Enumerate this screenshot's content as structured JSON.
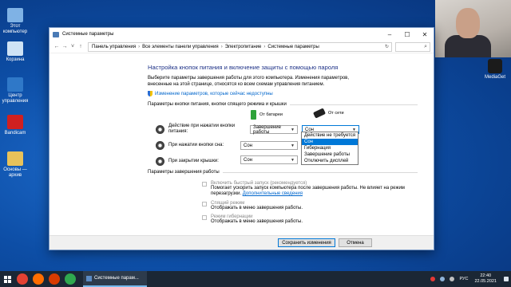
{
  "desktop": {
    "icons": [
      {
        "label": "Этот компьютер",
        "color": "#7fb2e5"
      },
      {
        "label": "Корзина",
        "color": "#cfe3f5"
      },
      {
        "label": "Центр управления",
        "color": "#2f78c8"
      },
      {
        "label": "Bandicam",
        "color": "#d02020"
      },
      {
        "label": "Основы — архив",
        "color": "#e8c25a"
      }
    ],
    "mediaget_label": "MediaGet"
  },
  "window": {
    "title": "Системные параметры",
    "address": {
      "crumbs": [
        "Панель управления",
        "Все элементы панели управления",
        "Электропитание",
        "Системные параметры"
      ]
    },
    "heading": "Настройка кнопок питания и включение защиты с помощью пароля",
    "description": "Выберите параметры завершения работы для этого компьютера. Изменения параметров, внесенные на этой странице, относятся ко всем схемам управления питанием.",
    "change_link": "Изменение параметров, которые сейчас недоступны",
    "section_buttons": "Параметры кнопки питания, кнопки спящего режима и крышки",
    "col_battery": "От батареи",
    "col_ac": "От сети",
    "rows": [
      {
        "label": "Действие при нажатии кнопки питания:",
        "battery": "Завершение работы",
        "ac": "Сон"
      },
      {
        "label": "При нажатии кнопки сна:",
        "battery": "Сон",
        "ac": ""
      },
      {
        "label": "При закрытии крышки:",
        "battery": "Сон",
        "ac": ""
      }
    ],
    "dropdown_menu": [
      "Действие не требуется",
      "Сон",
      "Гибернация",
      "Завершение работы",
      "Отключить дисплей"
    ],
    "dropdown_selected_index": 1,
    "section_shutdown": "Параметры завершения работы",
    "checkboxes": [
      {
        "label": "Включить быстрый запуск (рекомендуется)",
        "desc": "Помогает ускорить запуск компьютера после завершения работы. Не влияет на режим перезагрузки.",
        "link": "Дополнительные сведения"
      },
      {
        "label": "Спящий режим",
        "desc": "Отображать в меню завершения работы.",
        "link": ""
      },
      {
        "label": "Режим гибернации",
        "desc": "Отображать в меню завершения работы.",
        "link": ""
      }
    ],
    "save_label": "Сохранить изменения",
    "cancel_label": "Отмена"
  },
  "taskbar": {
    "app_label": "Системные парам...",
    "lang": "РУС",
    "time": "22:40",
    "date": "22.05.2021"
  }
}
